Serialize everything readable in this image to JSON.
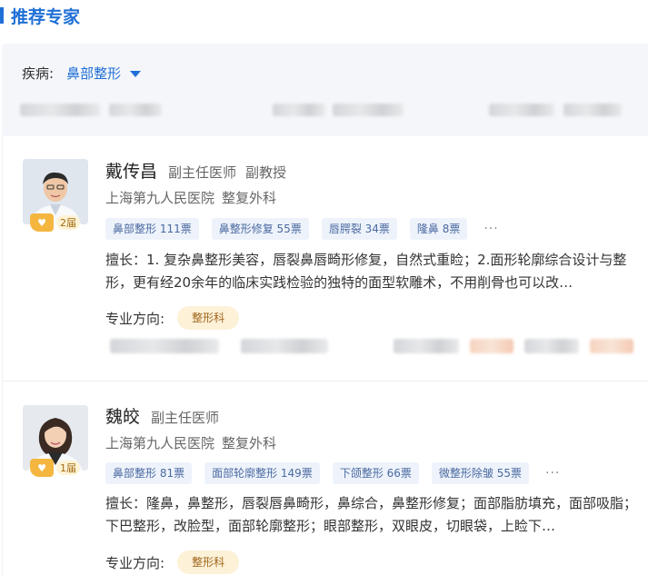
{
  "section": {
    "title": "推荐专家"
  },
  "filter": {
    "label": "疾病:",
    "value": "鼻部整形"
  },
  "doctors": [
    {
      "name": "戴传昌",
      "title": "副主任医师",
      "academic_title": "副教授",
      "hospital": "上海第九人民医院",
      "department": "整复外科",
      "badge": "2届",
      "tags": [
        "鼻部整形 111票",
        "鼻整形修复 55票",
        "唇腭裂 34票",
        "隆鼻 8票"
      ],
      "more": "···",
      "skill": "擅长：1. 复杂鼻整形美容，唇裂鼻唇畸形修复，自然式重睑；2.面形轮廓综合设计与整形，更有经20余年的临床实践检验的独特的面型软雕术，不用削骨也可以改…",
      "direction_label": "专业方向:",
      "direction": "整形科"
    },
    {
      "name": "魏皎",
      "title": "副主任医师",
      "academic_title": "",
      "hospital": "上海第九人民医院",
      "department": "整复外科",
      "badge": "1届",
      "tags": [
        "鼻部整形 81票",
        "面部轮廓整形 149票",
        "下颌整形 66票",
        "微整形除皱 55票"
      ],
      "more": "···",
      "skill": "擅长：隆鼻，鼻整形，唇裂唇鼻畸形，鼻综合，鼻整形修复；面部脂肪填充，面部吸脂；下巴整形，改脸型，面部轮廓整形；眼部整形，双眼皮，切眼袋，上睑下…",
      "direction_label": "专业方向:",
      "direction": "整形科"
    }
  ],
  "colors": {
    "accent": "#1f6fd6",
    "tag_bg": "#eef3fb",
    "pill_bg": "#fdf1d8"
  }
}
